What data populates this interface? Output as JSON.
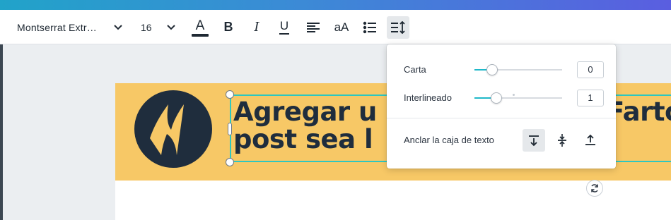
{
  "toolbar": {
    "font_family": "Montserrat Extr…",
    "font_size": "16",
    "text_color_glyph": "A",
    "bold_glyph": "B",
    "italic_glyph": "I",
    "underline_glyph": "U",
    "case_glyph": "aA",
    "icons": [
      "chevron-down-icon",
      "text-color-icon",
      "bold-icon",
      "italic-icon",
      "underline-icon",
      "align-left-icon",
      "letter-case-icon",
      "list-icon",
      "spacing-icon"
    ],
    "text_color_swatch": "#1f2933"
  },
  "canvas": {
    "headline_line1": "Agregar u",
    "headline_line1_right": "Farto",
    "headline_line2": "post sea l",
    "banner_color": "#f7c866",
    "text_color": "#1f2d3d",
    "selection_color": "#2ec7c0"
  },
  "spacing_panel": {
    "letter_label": "Carta",
    "letter_value": "0",
    "letter_slider_fraction": 0.2,
    "line_label": "Interlineado",
    "line_value": "1",
    "line_slider_fraction": 0.25,
    "anchor_label": "Anclar la caja de texto",
    "anchor_options": [
      "anchor-top-icon",
      "anchor-middle-icon",
      "anchor-bottom-icon"
    ],
    "anchor_selected": "top",
    "accent_color": "#1fb8c9"
  }
}
